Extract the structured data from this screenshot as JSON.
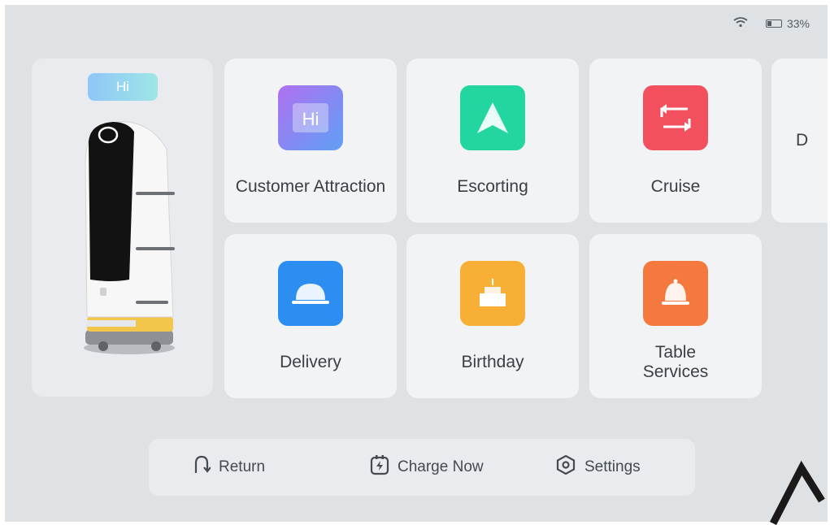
{
  "status": {
    "battery": "33%",
    "battery_level": 0.33
  },
  "robot_panel": {
    "badge": "Hi"
  },
  "tiles": [
    {
      "label": "Customer Attraction",
      "icon": "hi-icon",
      "color": "#7b7df0"
    },
    {
      "label": "Escorting",
      "icon": "navigation-arrow-icon",
      "color": "#23d6a0"
    },
    {
      "label": "Cruise",
      "icon": "loop-arrows-icon",
      "color": "#f2505e"
    },
    {
      "label": "D",
      "icon": "",
      "color": ""
    },
    {
      "label": "Delivery",
      "icon": "food-cloche-icon",
      "color": "#2d8ef2"
    },
    {
      "label": "Birthday",
      "icon": "cake-icon",
      "color": "#f7b035"
    },
    {
      "label": "Table Services",
      "icon": "bell-icon",
      "color": "#f5793e"
    }
  ],
  "bottom": {
    "return_label": "Return",
    "charge_label": "Charge Now",
    "settings_label": "Settings"
  }
}
